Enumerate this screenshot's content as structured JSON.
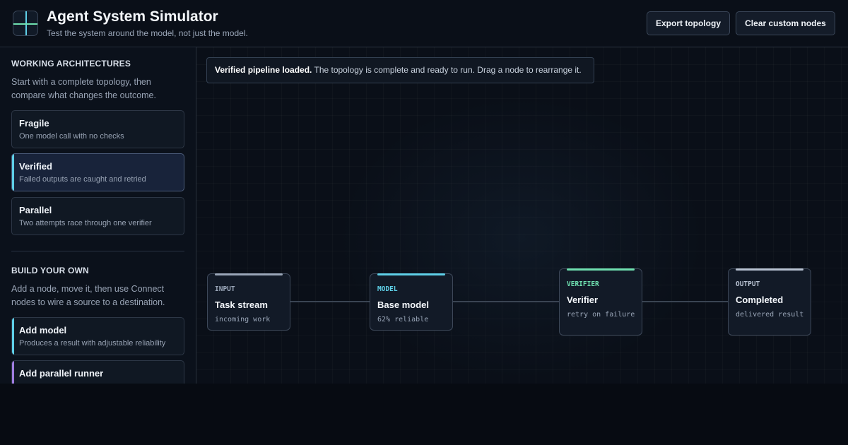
{
  "header": {
    "title": "Agent System Simulator",
    "subtitle": "Test the system around the model, not just the model.",
    "export_label": "Export topology",
    "clear_label": "Clear custom nodes",
    "logo_icon": "grid-logo-icon"
  },
  "sidebar": {
    "working": {
      "title": "WORKING ARCHITECTURES",
      "description": "Start with a complete topology, then compare what changes the outcome.",
      "cards": [
        {
          "title": "Fragile",
          "desc": "One model call with no checks"
        },
        {
          "title": "Verified",
          "desc": "Failed outputs are caught and retried",
          "selected": true,
          "accent": "#5fd0e8"
        },
        {
          "title": "Parallel",
          "desc": "Two attempts race through one verifier"
        }
      ]
    },
    "build": {
      "title": "BUILD YOUR OWN",
      "description": "Add a node, move it, then use Connect nodes to wire a source to a destination.",
      "cards": [
        {
          "title": "Add model",
          "desc": "Produces a result with adjustable reliability",
          "accent": "#5fd0e8"
        },
        {
          "title": "Add parallel runner",
          "desc": "",
          "accent": "#a07ee0"
        }
      ]
    }
  },
  "canvas": {
    "banner": {
      "bold": "Verified pipeline loaded.",
      "text": " The topology is complete and ready to run. Drag a node to rearrange it."
    },
    "nodes": [
      {
        "type": "INPUT",
        "name": "Task stream",
        "detail": "incoming work",
        "color": "#9aa6b8"
      },
      {
        "type": "MODEL",
        "name": "Base model",
        "detail": "62% reliable",
        "color": "#5fd0e8"
      },
      {
        "type": "VERIFIER",
        "name": "Verifier",
        "detail": "retry on failure",
        "color": "#6fe0b0"
      },
      {
        "type": "OUTPUT",
        "name": "Completed",
        "detail": "delivered result",
        "color": "#b8c2d2"
      }
    ]
  },
  "colors": {
    "accent_model": "#5fd0e8",
    "accent_verifier": "#6fe0b0",
    "accent_parallel": "#a07ee0"
  }
}
